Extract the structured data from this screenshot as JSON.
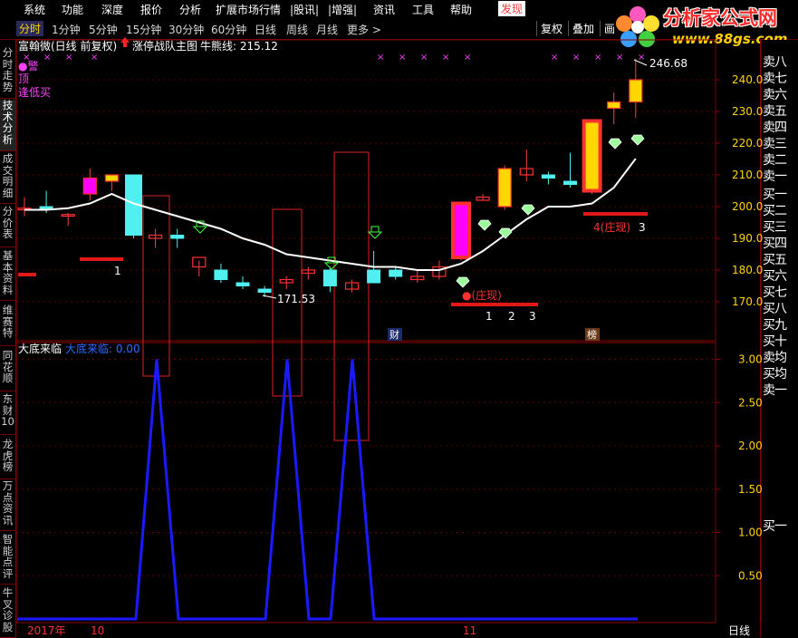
{
  "menu": {
    "items": [
      "系统",
      "功能",
      "深度",
      "报价",
      "分析",
      "扩展市场行情",
      "|股讯|",
      "|增强|",
      "资讯",
      "工具",
      "帮助"
    ],
    "highlight": "发现"
  },
  "toolbar": {
    "periods": [
      "分时",
      "1分钟",
      "5分钟",
      "15分钟",
      "30分钟",
      "60分钟",
      "日线",
      "周线",
      "月线",
      "更多 >"
    ],
    "active_period": "日线",
    "right_buttons": [
      "复权",
      "叠加",
      "画"
    ]
  },
  "side_tabs": [
    "分时走势",
    "技术分析",
    "成交明细",
    "分价表",
    "基本资料",
    "维赛特",
    "同花顺",
    "东财10",
    "龙虎榜",
    "万点资讯",
    "智能点评",
    "牛叉诊股"
  ],
  "side_tabs_active": "技术分析",
  "logo": {
    "name": "分析家公式网",
    "url": "www.88gs.com"
  },
  "main_panel": {
    "stock_title": "富翰微(日线 前复权)",
    "indicator_name": "涨停战队主图",
    "ma_label": "牛熊线: 215.12",
    "legend": [
      "●警",
      "顶",
      "逢低买"
    ],
    "high_label": "246.68",
    "low_label": "171.53",
    "zhuang_label": "●(庄现)",
    "zhuang_label_2": "4(庄现)",
    "counters_1": [
      "1",
      "2",
      "3"
    ],
    "counter_left": "1",
    "counter_right": "3",
    "badges": [
      "财",
      "榜"
    ]
  },
  "sub_panel": {
    "title": "大底来临",
    "series_label": "大底来临: 0.00"
  },
  "dates": {
    "year": "2017年",
    "m1": "10",
    "m2": "11"
  },
  "period_label": "日线",
  "order_book": {
    "sell": [
      "卖八",
      "卖七",
      "卖六",
      "卖五",
      "卖四",
      "卖三",
      "卖二",
      "卖一"
    ],
    "buy": [
      "买一",
      "买二",
      "买三",
      "买四",
      "买五",
      "买六",
      "买七",
      "买八",
      "买九",
      "买十"
    ],
    "summary": [
      "卖均",
      "买均",
      "卖一"
    ],
    "bottom": "买一"
  },
  "colors": {
    "up_candle": "#ff2020",
    "down_candle": "#50f0f0",
    "ma_line": "#ffffff",
    "dadi_line": "#1a1aff",
    "grid": "#8a0000",
    "axis_text": "#ffd200"
  },
  "chart_data": [
    {
      "type": "candlestick",
      "title": "富翰微(日线 前复权)",
      "ylim": [
        163,
        252
      ],
      "yticks": [
        170.0,
        180.0,
        190.0,
        200.0,
        210.0,
        220.0,
        230.0,
        240.0
      ],
      "candles": [
        {
          "o": 199,
          "h": 203,
          "l": 197,
          "c": 199.5
        },
        {
          "o": 200,
          "h": 205,
          "l": 198,
          "c": 199
        },
        {
          "o": 197,
          "h": 198,
          "l": 194,
          "c": 197.5
        },
        {
          "o": 204,
          "h": 212,
          "l": 202,
          "c": 209
        },
        {
          "o": 208,
          "h": 210,
          "l": 205,
          "c": 210
        },
        {
          "o": 210,
          "h": 210,
          "l": 190,
          "c": 191
        },
        {
          "o": 190,
          "h": 193,
          "l": 187,
          "c": 191
        },
        {
          "o": 191,
          "h": 193,
          "l": 187,
          "c": 190
        },
        {
          "o": 181,
          "h": 183,
          "l": 178,
          "c": 184
        },
        {
          "o": 180,
          "h": 182,
          "l": 176,
          "c": 177
        },
        {
          "o": 176,
          "h": 178,
          "l": 174,
          "c": 175
        },
        {
          "o": 174,
          "h": 175,
          "l": 171.53,
          "c": 173
        },
        {
          "o": 176,
          "h": 178,
          "l": 174,
          "c": 177
        },
        {
          "o": 179,
          "h": 181,
          "l": 177,
          "c": 180
        },
        {
          "o": 180,
          "h": 181,
          "l": 173,
          "c": 175
        },
        {
          "o": 174,
          "h": 177,
          "l": 173,
          "c": 176
        },
        {
          "o": 180,
          "h": 186,
          "l": 176,
          "c": 176
        },
        {
          "o": 180,
          "h": 181,
          "l": 177,
          "c": 178
        },
        {
          "o": 177,
          "h": 180,
          "l": 176,
          "c": 178
        },
        {
          "o": 178,
          "h": 183,
          "l": 177,
          "c": 181
        },
        {
          "o": 184,
          "h": 184,
          "l": 183,
          "c": 201
        },
        {
          "o": 202,
          "h": 204,
          "l": 202,
          "c": 203
        },
        {
          "o": 200,
          "h": 213,
          "l": 199,
          "c": 212
        },
        {
          "o": 210,
          "h": 218,
          "l": 208,
          "c": 212
        },
        {
          "o": 210,
          "h": 211,
          "l": 207,
          "c": 209
        },
        {
          "o": 208,
          "h": 217,
          "l": 206,
          "c": 207
        },
        {
          "o": 205,
          "h": 227,
          "l": 204,
          "c": 227
        },
        {
          "o": 231,
          "h": 236,
          "l": 226,
          "c": 233
        },
        {
          "o": 233,
          "h": 246.68,
          "l": 228,
          "c": 240
        }
      ],
      "ma_label": "牛熊线",
      "ma_last": 215.12,
      "ma": [
        199,
        199,
        199.5,
        201,
        204,
        201,
        199,
        197,
        195,
        193,
        190,
        188,
        185,
        184,
        183,
        182,
        181,
        181,
        180,
        180,
        182,
        186,
        191,
        196,
        200,
        200,
        201,
        206,
        215.12
      ],
      "high": 246.68,
      "low": 171.53
    },
    {
      "type": "line",
      "title": "大底来临",
      "series": [
        {
          "name": "大底来临",
          "values": [
            0,
            0,
            0,
            0,
            0,
            0,
            3,
            0,
            0,
            0,
            0,
            0,
            3,
            0,
            0,
            3,
            0,
            0,
            0,
            0,
            0,
            0,
            0,
            0,
            0,
            0,
            0,
            0,
            0
          ]
        }
      ],
      "ylim": [
        0,
        3.2
      ],
      "yticks": [
        0.5,
        1.0,
        1.5,
        2.0,
        2.5,
        3.0
      ]
    }
  ]
}
